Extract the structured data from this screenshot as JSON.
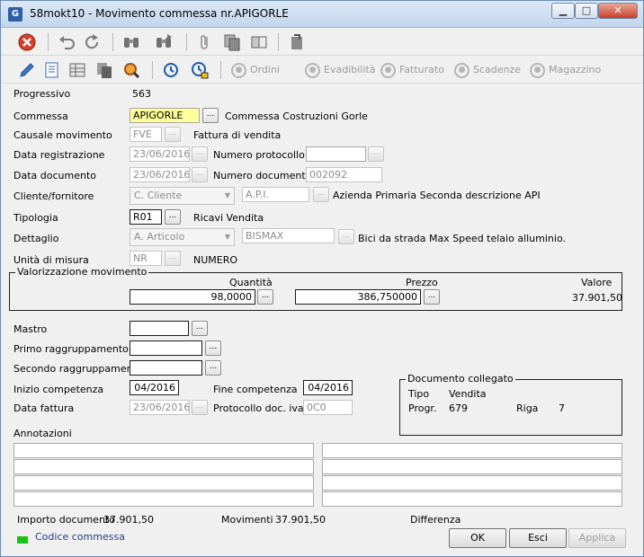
{
  "window": {
    "title": "58mokt10 - Movimento commessa nr.APIGORLE",
    "app_icon": "app-logo-icon",
    "buttons": {
      "minimize": "▁",
      "maximize": "□",
      "close": "✕"
    }
  },
  "toolbar2": {
    "ordini": "Ordini",
    "evadibilita": "Evadibilità",
    "fatturato": "Fatturato",
    "scadenze": "Scadenze",
    "magazzino": "Magazzino"
  },
  "form": {
    "progressivo": {
      "label": "Progressivo",
      "value": "563"
    },
    "commessa": {
      "label": "Commessa",
      "value": "APIGORLE",
      "desc": "Commessa Costruzioni Gorle"
    },
    "causale": {
      "label": "Causale movimento",
      "value": "FVE",
      "desc": "Fattura di vendita"
    },
    "data_registrazione": {
      "label": "Data registrazione",
      "value": "23/06/2016"
    },
    "numero_protocollo": {
      "label": "Numero protocollo",
      "value": ""
    },
    "data_documento": {
      "label": "Data documento",
      "value": "23/06/2016"
    },
    "numero_documento": {
      "label": "Numero documento",
      "value": "002092"
    },
    "cliente": {
      "label": "Cliente/fornitore",
      "type": "C. Cliente",
      "code": "A.P.I.",
      "desc": "Azienda Primaria Seconda descrizione API"
    },
    "tipologia": {
      "label": "Tipologia",
      "value": "R01",
      "desc": "Ricavi Vendita"
    },
    "dettaglio": {
      "label": "Dettaglio",
      "type": "A. Articolo",
      "code": "BISMAX",
      "desc": "Bici da strada Max Speed telaio alluminio."
    },
    "unita": {
      "label": "Unità di misura",
      "value": "NR",
      "desc": "NUMERO"
    }
  },
  "valorizzazione": {
    "title": "Valorizzazione movimento",
    "quantita_label": "Quantità",
    "quantita": "98,0000",
    "prezzo_label": "Prezzo",
    "prezzo": "386,750000",
    "valore_label": "Valore",
    "valore": "37.901,50"
  },
  "lower": {
    "mastro": "Mastro",
    "primo": "Primo raggruppamento",
    "secondo": "Secondo raggruppamento",
    "inizio_label": "Inizio competenza",
    "inizio": "04/2016",
    "fine_label": "Fine competenza",
    "fine": "04/2016",
    "data_fattura_label": "Data fattura",
    "data_fattura": "23/06/2016",
    "protocollo_label": "Protocollo doc. iva",
    "protocollo": "0C0"
  },
  "documento": {
    "title": "Documento collegato",
    "tipo_label": "Tipo",
    "tipo": "Vendita",
    "progr_label": "Progr.",
    "progr": "679",
    "riga_label": "Riga",
    "riga": "7"
  },
  "annotazioni": {
    "label": "Annotazioni"
  },
  "totals": {
    "importo_label": "Importo documento",
    "importo": "37.901,50",
    "movimenti_label": "Movimenti",
    "movimenti": "37.901,50",
    "differenza_label": "Differenza"
  },
  "status": {
    "legend": "Codice commessa",
    "legend_color": "#17c217",
    "ok": "OK",
    "esci": "Esci",
    "applica": "Applica"
  },
  "ellipsis": "..."
}
